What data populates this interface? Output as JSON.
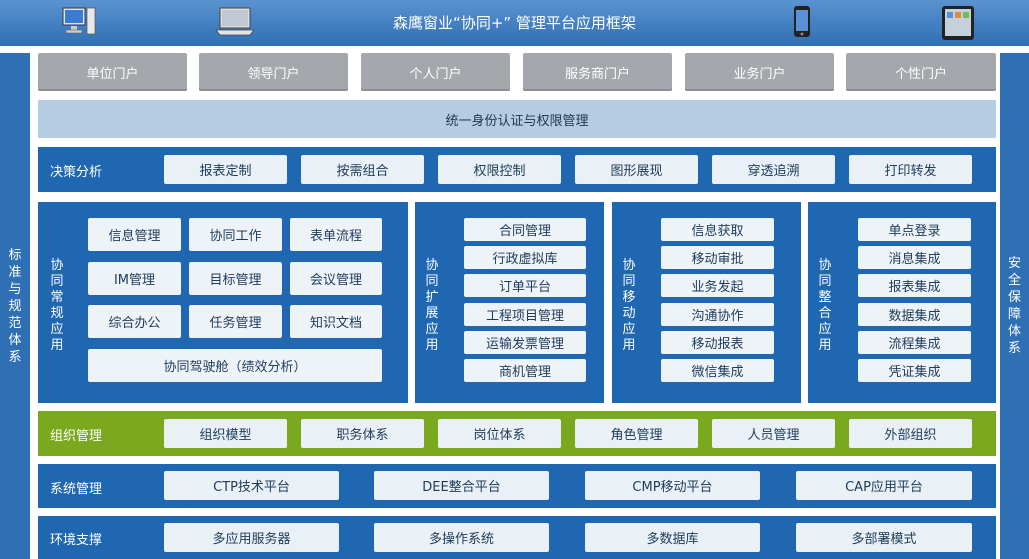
{
  "header": {
    "title": "森鹰窗业“协同+” 管理平台应用框架"
  },
  "devices": [
    "desktop-icon",
    "laptop-icon",
    "phone-icon",
    "tablet-icon"
  ],
  "side_left": "标准与规范体系",
  "side_right": "安全保障体系",
  "portals": [
    "单位门户",
    "领导门户",
    "个人门户",
    "服务商门户",
    "业务门户",
    "个性门户"
  ],
  "auth": "统一身份认证与权限管理",
  "decision": {
    "label": "决策分析",
    "items": [
      "报表定制",
      "按需组合",
      "权限控制",
      "图形展现",
      "穿透追溯",
      "打印转发"
    ]
  },
  "regular": {
    "label": "协同常规应用",
    "items": [
      "信息管理",
      "协同工作",
      "表单流程",
      "IM管理",
      "目标管理",
      "会议管理",
      "综合办公",
      "任务管理",
      "知识文档"
    ],
    "wide": "协同驾驶舱（绩效分析）"
  },
  "extend": {
    "label": "协同扩展应用",
    "items": [
      "合同管理",
      "行政虚拟库",
      "订单平台",
      "工程项目管理",
      "运输发票管理",
      "商机管理"
    ]
  },
  "mobile": {
    "label": "协同移动应用",
    "items": [
      "信息获取",
      "移动审批",
      "业务发起",
      "沟通协作",
      "移动报表",
      "微信集成"
    ]
  },
  "integrate": {
    "label": "协同整合应用",
    "items": [
      "单点登录",
      "消息集成",
      "报表集成",
      "数据集成",
      "流程集成",
      "凭证集成"
    ]
  },
  "org": {
    "label": "组织管理",
    "items": [
      "组织模型",
      "职务体系",
      "岗位体系",
      "角色管理",
      "人员管理",
      "外部组织"
    ]
  },
  "system": {
    "label": "系统管理",
    "items": [
      "CTP技术平台",
      "DEE整合平台",
      "CMP移动平台",
      "CAP应用平台"
    ]
  },
  "env": {
    "label": "环境支撑",
    "items": [
      "多应用服务器",
      "多操作系统",
      "多数据库",
      "多部署模式"
    ]
  },
  "colors": {
    "header": "#2f6fb3",
    "band": "#1f67b1",
    "org": "#7aa81e",
    "portal": "#a4a8ad",
    "auth": "#b5cde2"
  }
}
